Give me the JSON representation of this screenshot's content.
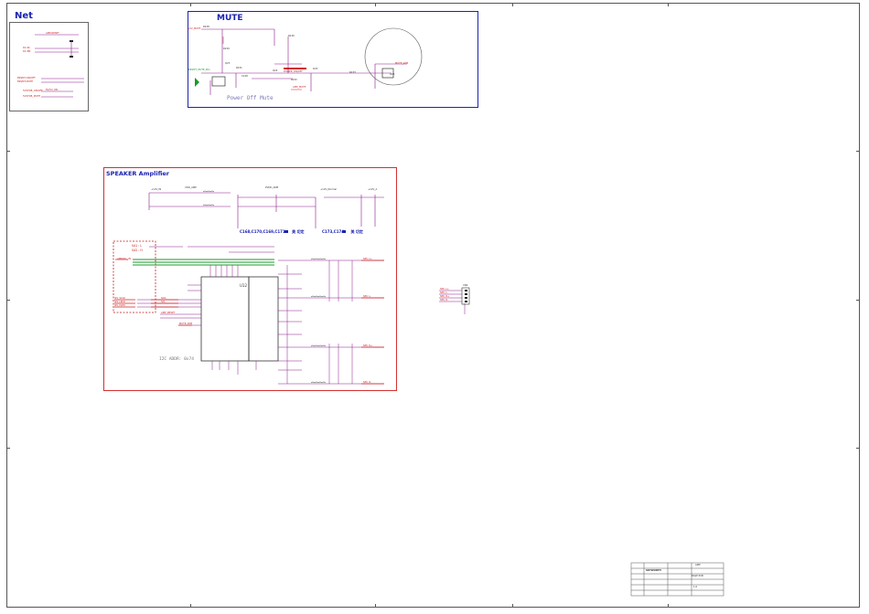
{
  "sheet": {
    "net_title": "Net",
    "mute_title": "MUTE",
    "speaker_title": "SPEAKER Amplifier",
    "power_off_mute": "Power Off Mute",
    "i2c_addr_note": "I2C ADDR: 0x74",
    "cap_note_left": "C168,C170,C169,C171",
    "cap_note_left_suffix": "美 切定",
    "cap_note_right": "C173,C174",
    "cap_note_right_suffix": "美 切定",
    "addr_option_1": "SA1 : L",
    "addr_option_2": "SA2 : H"
  },
  "net_block": {
    "labels": [
      "AMP-RESET",
      "DC-IN",
      "DC-EN",
      "BKSMT-ON/OFF",
      "BKSMT-MUTE",
      "5VSTDB_ON/OFF",
      "5VSTDB_MUTE",
      "8V/5V_ON"
    ]
  },
  "mute_block": {
    "labels": [
      "+5V_MUTE",
      "BKSMT_MUTE_PA1",
      "POWER_ON/OFF",
      "MUTE_AMP",
      "AMP_MUTE"
    ],
    "components": [
      "R228",
      "R229",
      "R230",
      "R231",
      "Q23",
      "Q24",
      "Q25",
      "D23",
      "C148",
      "R232",
      "R233"
    ]
  },
  "speaker_block": {
    "rail_labels": [
      "+12V_IN",
      "VDD_AMP",
      "PVDD_AMP",
      "+12V_Normal",
      "+12V_A"
    ],
    "left_labels": [
      "AMP-PLL_IN",
      "I2S_SCLK",
      "I2S_LRCK",
      "I2S_DATA",
      "SDA",
      "SCL",
      "AMP_RESET",
      "MUTE_AMP"
    ],
    "right_labels": [
      "SPK_L+",
      "SPK_L-",
      "SPK_R+",
      "SPK_R-"
    ],
    "ic_name": "U12"
  },
  "connector": {
    "labels": [
      "SPK_L+",
      "SPK_L-",
      "SPK_R+",
      "SPK_R-"
    ],
    "ref": "CN4"
  },
  "title_block": {
    "company": "SKYWORTH",
    "sheet_name": "AMP",
    "model": "BASE PCB",
    "rev": "1.0"
  },
  "colors": {
    "frame": "#555555",
    "box_blue": "#1b22b0",
    "box_red": "#d23030",
    "wire": "#8a1a8a",
    "net_red": "#d12020",
    "green_bus": "#1a9a2a"
  }
}
